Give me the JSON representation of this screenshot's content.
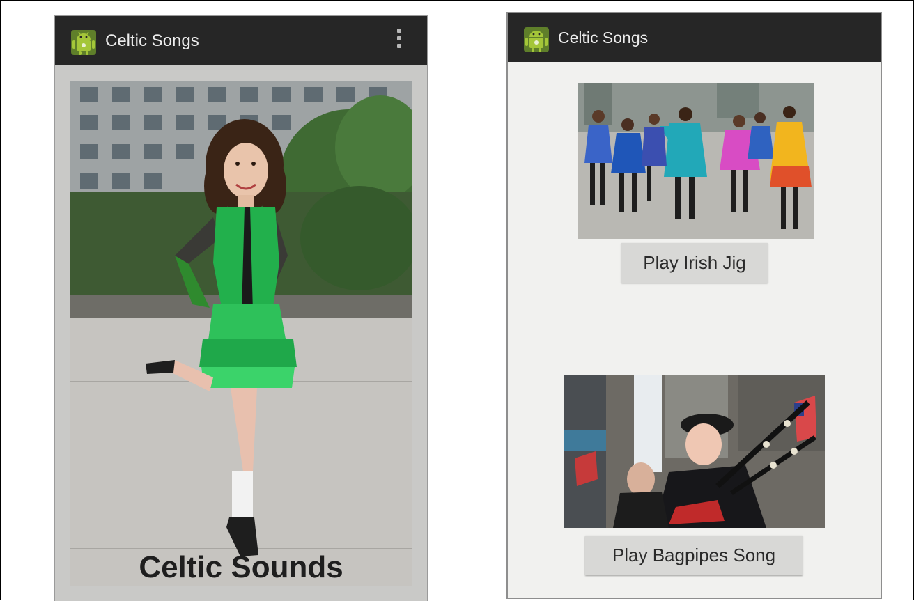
{
  "left_screen": {
    "app_title": "Celtic Songs",
    "caption": "Celtic Sounds",
    "icons": [
      "android-icon",
      "overflow-menu-icon"
    ]
  },
  "right_screen": {
    "app_title": "Celtic Songs",
    "buttons": {
      "jig_label": "Play Irish Jig",
      "bagpipes_label": "Play Bagpipes Song"
    },
    "icons": [
      "android-icon"
    ]
  },
  "colors": {
    "action_bar": "#262626",
    "title_text": "#ececec",
    "button_bg": "#d8d8d6",
    "dress_green": "#22b04c",
    "screen_bg": "#f1f1ef"
  }
}
